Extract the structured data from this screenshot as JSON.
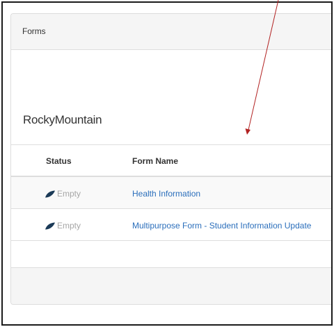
{
  "panel": {
    "title": "Forms",
    "school_name": "RockyMountain"
  },
  "table": {
    "headers": {
      "status": "Status",
      "form_name": "Form Name"
    },
    "rows": [
      {
        "status": "Empty",
        "status_icon": "leaf-icon",
        "form_name": "Health Information"
      },
      {
        "status": "Empty",
        "status_icon": "leaf-icon",
        "form_name": "Multipurpose Form - Student Information Update"
      }
    ]
  },
  "colors": {
    "link": "#2a6ebb",
    "status_text": "#a6a6a6",
    "status_icon": "#1b3a57",
    "annotation_arrow": "#b22222"
  },
  "annotation": {
    "icon": "red-arrow-icon"
  }
}
